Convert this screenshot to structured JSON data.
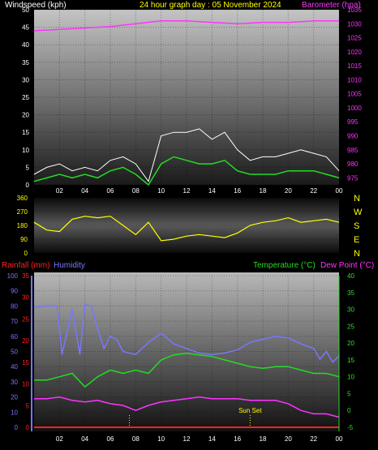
{
  "header": {
    "wind_label": "Windspeed (kph)",
    "title": "24 hour graph day : 05 November 2024",
    "baro_label": "Barometer (hpa)"
  },
  "bottom_header": {
    "rain_label": "Rainfall (mm)",
    "humidity_label": "Humidity",
    "temp_label": "Temperature (°C)",
    "dew_label": "Dew Point (°C)"
  },
  "compass": [
    "N",
    "W",
    "S",
    "E",
    "N"
  ],
  "sunset_label": "Sun Set",
  "colors": {
    "wind_gust": "#ffffff",
    "wind_avg": "#22dd22",
    "barometer": "#ff33ff",
    "direction": "#ffff00",
    "humidity": "#7777ff",
    "temperature": "#22dd22",
    "dew_point": "#ff33ff",
    "rainfall": "#ff2222",
    "temp_axis": "#33dd33",
    "sunset": "#ffff00"
  },
  "chart_data": [
    {
      "type": "line",
      "x_ticks": [
        "02",
        "04",
        "06",
        "08",
        "10",
        "12",
        "14",
        "16",
        "18",
        "20",
        "22",
        "00"
      ],
      "series": [
        {
          "name": "Windspeed (kph)",
          "axis": "left",
          "role": "gust",
          "hours": [
            0,
            1,
            2,
            3,
            4,
            5,
            6,
            7,
            8,
            9,
            10,
            11,
            12,
            13,
            14,
            15,
            16,
            17,
            18,
            19,
            20,
            21,
            22,
            23,
            24
          ],
          "values": [
            3,
            5,
            6,
            4,
            5,
            4,
            7,
            8,
            6,
            1,
            14,
            15,
            15,
            16,
            13,
            15,
            10,
            7,
            8,
            8,
            9,
            10,
            9,
            8,
            4
          ]
        },
        {
          "name": "Windspeed (kph) average",
          "axis": "left",
          "role": "avg",
          "hours": [
            0,
            1,
            2,
            3,
            4,
            5,
            6,
            7,
            8,
            9,
            10,
            11,
            12,
            13,
            14,
            15,
            16,
            17,
            18,
            19,
            20,
            21,
            22,
            23,
            24
          ],
          "values": [
            1,
            2,
            3,
            2,
            3,
            2,
            4,
            5,
            3,
            0,
            6,
            8,
            7,
            6,
            6,
            7,
            4,
            3,
            3,
            3,
            4,
            4,
            4,
            3,
            2
          ]
        },
        {
          "name": "Barometer (hpa)",
          "axis": "right",
          "hours": [
            0,
            2,
            4,
            6,
            8,
            10,
            12,
            14,
            16,
            18,
            20,
            22,
            24
          ],
          "values": [
            1027.5,
            1028,
            1028.5,
            1029,
            1030,
            1031,
            1031,
            1030.5,
            1030,
            1030.5,
            1030.5,
            1031,
            1031
          ]
        }
      ],
      "y_left": {
        "ticks": [
          0,
          5,
          10,
          15,
          20,
          25,
          30,
          35,
          40,
          45,
          50
        ],
        "ylim": [
          0,
          50
        ]
      },
      "y_right": {
        "ticks": [
          975,
          980,
          985,
          990,
          995,
          1000,
          1005,
          1010,
          1015,
          1020,
          1025,
          1030,
          1035
        ],
        "ylim": [
          972.5,
          1035
        ]
      },
      "grid": true
    },
    {
      "type": "line",
      "series": [
        {
          "name": "Wind direction",
          "hours": [
            0,
            1,
            2,
            3,
            4,
            5,
            6,
            7,
            8,
            9,
            10,
            11,
            12,
            13,
            14,
            15,
            16,
            17,
            18,
            19,
            20,
            21,
            22,
            23,
            24
          ],
          "values": [
            200,
            150,
            140,
            220,
            240,
            230,
            240,
            180,
            120,
            200,
            80,
            90,
            110,
            120,
            110,
            100,
            130,
            180,
            200,
            210,
            230,
            200,
            210,
            220,
            200
          ]
        }
      ],
      "y_ticks": [
        0,
        90,
        180,
        270,
        360
      ],
      "ylim": [
        0,
        360
      ],
      "grid": true
    },
    {
      "type": "line",
      "x_ticks": [
        "02",
        "04",
        "06",
        "08",
        "10",
        "12",
        "14",
        "16",
        "18",
        "20",
        "22",
        "00"
      ],
      "series": [
        {
          "name": "Humidity",
          "axis": "humidity",
          "hours": [
            0,
            1,
            1.8,
            2.2,
            3,
            3.6,
            4,
            4.5,
            5,
            5.5,
            6,
            6.5,
            7,
            8,
            9,
            10,
            11,
            12,
            13,
            14,
            15,
            16,
            17,
            18,
            19,
            20,
            21,
            22,
            22.5,
            23,
            23.5,
            24
          ],
          "values": [
            79,
            80,
            80,
            48,
            78,
            48,
            81,
            80,
            65,
            52,
            60,
            58,
            50,
            48,
            56,
            62,
            55,
            52,
            49,
            48,
            49,
            51,
            56,
            58,
            60,
            59,
            55,
            52,
            45,
            50,
            43,
            47
          ]
        },
        {
          "name": "Temperature (°C)",
          "axis": "temperature",
          "hours": [
            0,
            1,
            2,
            3,
            4,
            5,
            6,
            7,
            8,
            9,
            10,
            11,
            12,
            13,
            14,
            15,
            16,
            17,
            18,
            19,
            20,
            21,
            22,
            23,
            24
          ],
          "values": [
            9,
            9,
            10,
            11,
            7,
            10,
            12,
            11,
            12,
            11,
            15,
            16.5,
            17,
            16.5,
            16,
            15,
            14,
            13,
            12.5,
            13,
            13,
            12,
            11,
            11,
            10
          ]
        },
        {
          "name": "Dew Point (°C)",
          "axis": "temperature",
          "hours": [
            0,
            1,
            2,
            3,
            4,
            5,
            6,
            7,
            8,
            9,
            10,
            11,
            12,
            13,
            14,
            15,
            16,
            17,
            18,
            19,
            20,
            21,
            22,
            23,
            24
          ],
          "values": [
            3.5,
            3.5,
            4,
            3,
            2.5,
            3,
            2,
            1.5,
            0,
            1.5,
            2.5,
            3,
            3.5,
            4,
            3.5,
            3.5,
            3.5,
            3,
            3,
            3,
            2,
            0,
            -1,
            -1,
            -2
          ]
        },
        {
          "name": "Rainfall (mm)",
          "axis": "rainfall",
          "hours": [
            0,
            24
          ],
          "values": [
            0,
            0
          ]
        }
      ],
      "y_humidity": {
        "ticks": [
          0,
          10,
          20,
          30,
          40,
          50,
          60,
          70,
          80,
          90,
          100
        ],
        "ylim": [
          0,
          100
        ]
      },
      "y_rainfall": {
        "ticks": [
          0,
          5,
          10,
          15,
          20,
          25,
          30,
          35
        ],
        "ylim": [
          0,
          35
        ]
      },
      "y_temperature": {
        "ticks": [
          -5,
          0,
          5,
          10,
          15,
          20,
          25,
          30,
          35,
          40
        ],
        "ylim": [
          -5,
          40
        ]
      },
      "annotations": [
        {
          "text": "Sun Set",
          "hour": 17
        },
        {
          "text": "",
          "hour": 7.5
        }
      ],
      "grid": true
    }
  ]
}
